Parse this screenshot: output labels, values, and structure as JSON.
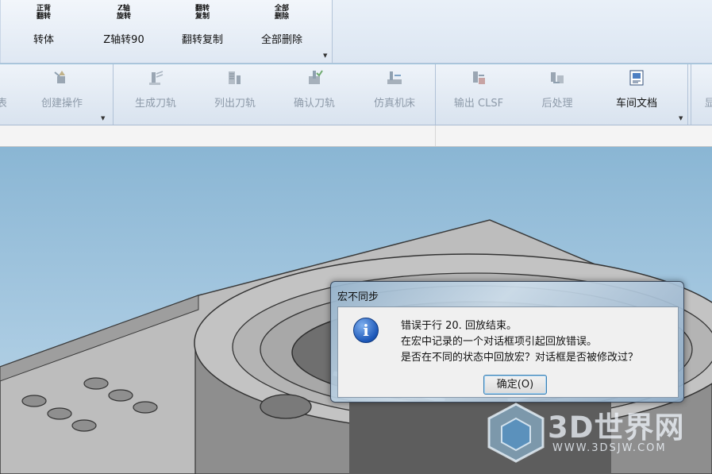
{
  "ribbon_top": {
    "buttons": [
      {
        "icon_text": "正背\n翻转",
        "label": "转体"
      },
      {
        "icon_text": "Z轴\n旋转",
        "label": "Z轴转90"
      },
      {
        "icon_text": "翻转\n复制",
        "label": "翻转复制"
      },
      {
        "icon_text": "全部\n删除",
        "label": "全部删除"
      }
    ]
  },
  "ribbon_ops": {
    "partial_left_label": "表",
    "create_operation": "创建操作",
    "generate_toolpath": "生成刀轨",
    "list_toolpath": "列出刀轨",
    "verify_toolpath": "确认刀轨",
    "simulate_machine": "仿真机床",
    "output_clsf": "输出 CLSF",
    "postprocess": "后处理",
    "shop_docs": "车间文档",
    "partial_right_label": "显"
  },
  "dialog": {
    "title": "宏不同步",
    "icon": "info-icon",
    "line1": "错误于行 20. 回放结束。",
    "line2": "在宏中记录的一个对话框项引起回放错误。",
    "line3": "是否在不同的状态中回放宏？对话框是否被修改过？",
    "ok_label": "确定(O)"
  },
  "watermark": {
    "text": "3D世界网",
    "url": "WWW.3DSJW.COM"
  },
  "colors": {
    "viewport_sky": "#9cc3dc",
    "part_gray": "#b9b9b9",
    "dialog_focus": "#3c7fb1"
  }
}
